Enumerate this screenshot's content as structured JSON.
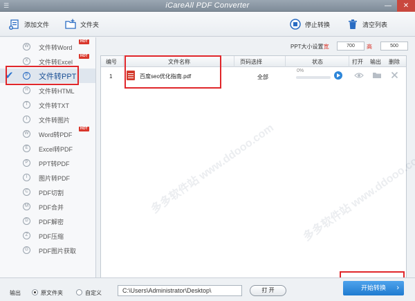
{
  "window": {
    "title": "iCareAll PDF Converter",
    "menu_glyph": "☰",
    "minimize_glyph": "—",
    "close_glyph": "✕"
  },
  "toolbar": {
    "add_file": "添加文件",
    "add_folder": "文件夹",
    "stop": "停止转换",
    "clear": "清空列表"
  },
  "sidebar": {
    "hot_badge": "HOT",
    "items": [
      {
        "label": "文件转Word",
        "hot": true
      },
      {
        "label": "文件转Excel",
        "hot": true
      },
      {
        "label": "文件转PPT",
        "hot": false
      },
      {
        "label": "文件转HTML",
        "hot": false
      },
      {
        "label": "文件转TXT",
        "hot": false
      },
      {
        "label": "文件转图片",
        "hot": false
      },
      {
        "label": "Word转PDF",
        "hot": true
      },
      {
        "label": "Excel转PDF",
        "hot": false
      },
      {
        "label": "PPT转PDF",
        "hot": false
      },
      {
        "label": "图片转PDF",
        "hot": false
      },
      {
        "label": "PDF切割",
        "hot": false
      },
      {
        "label": "PDF合并",
        "hot": false
      },
      {
        "label": "PDF解密",
        "hot": false
      },
      {
        "label": "PDF压缩",
        "hot": false
      },
      {
        "label": "PDF图片获取",
        "hot": false
      }
    ],
    "active_index": 2
  },
  "ppt_size": {
    "label": "PPT大小设置",
    "width_label": "宽",
    "height_label": "高",
    "width_value": "700",
    "height_value": "500"
  },
  "table": {
    "headers": [
      "编号",
      "文件名称",
      "页码选择",
      "状态",
      "打开",
      "输出",
      "删除"
    ],
    "rows": [
      {
        "index": "1",
        "filename": "百度seo优化指南.pdf",
        "pages": "全部",
        "progress_text": "0%",
        "progress": 0
      }
    ]
  },
  "bottom": {
    "output_label": "输出",
    "option_source": "原文件夹",
    "option_custom": "自定义",
    "path": "C:\\Users\\Administrator\\Desktop\\",
    "open_label": "打 开",
    "start_label": "开始转换",
    "start_chevron": "›"
  },
  "watermark": "多多软件站  www.ddooo.com",
  "colors": {
    "accent": "#2a74cf",
    "hot": "#d9362b",
    "annotation_box": "#e0262a"
  }
}
